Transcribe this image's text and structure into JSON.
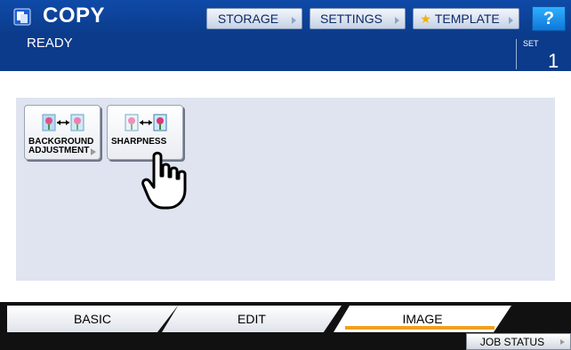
{
  "header": {
    "title": "COPY",
    "status": "READY",
    "buttons": {
      "storage": "STORAGE",
      "settings": "SETTINGS",
      "template": "TEMPLATE",
      "help": "?"
    },
    "set": {
      "label": "SET",
      "value": "1"
    }
  },
  "functions": [
    {
      "line1": "BACKGROUND",
      "line2": "ADJUSTMENT"
    },
    {
      "line1": "SHARPNESS",
      "line2": ""
    }
  ],
  "tabs": [
    {
      "label": "BASIC",
      "active": false
    },
    {
      "label": "EDIT",
      "active": false
    },
    {
      "label": "IMAGE",
      "active": true
    }
  ],
  "footer": {
    "job_status": "JOB STATUS"
  },
  "colors": {
    "header_bg": "#0b3b8a",
    "panel_bg": "#dfe4f0",
    "active_tab_underline": "#f0a020",
    "help_button": "#1e90ff"
  },
  "icons": {
    "app": "copier-icon",
    "functions": "image-transform-icon",
    "pointer": "hand-cursor-icon"
  }
}
